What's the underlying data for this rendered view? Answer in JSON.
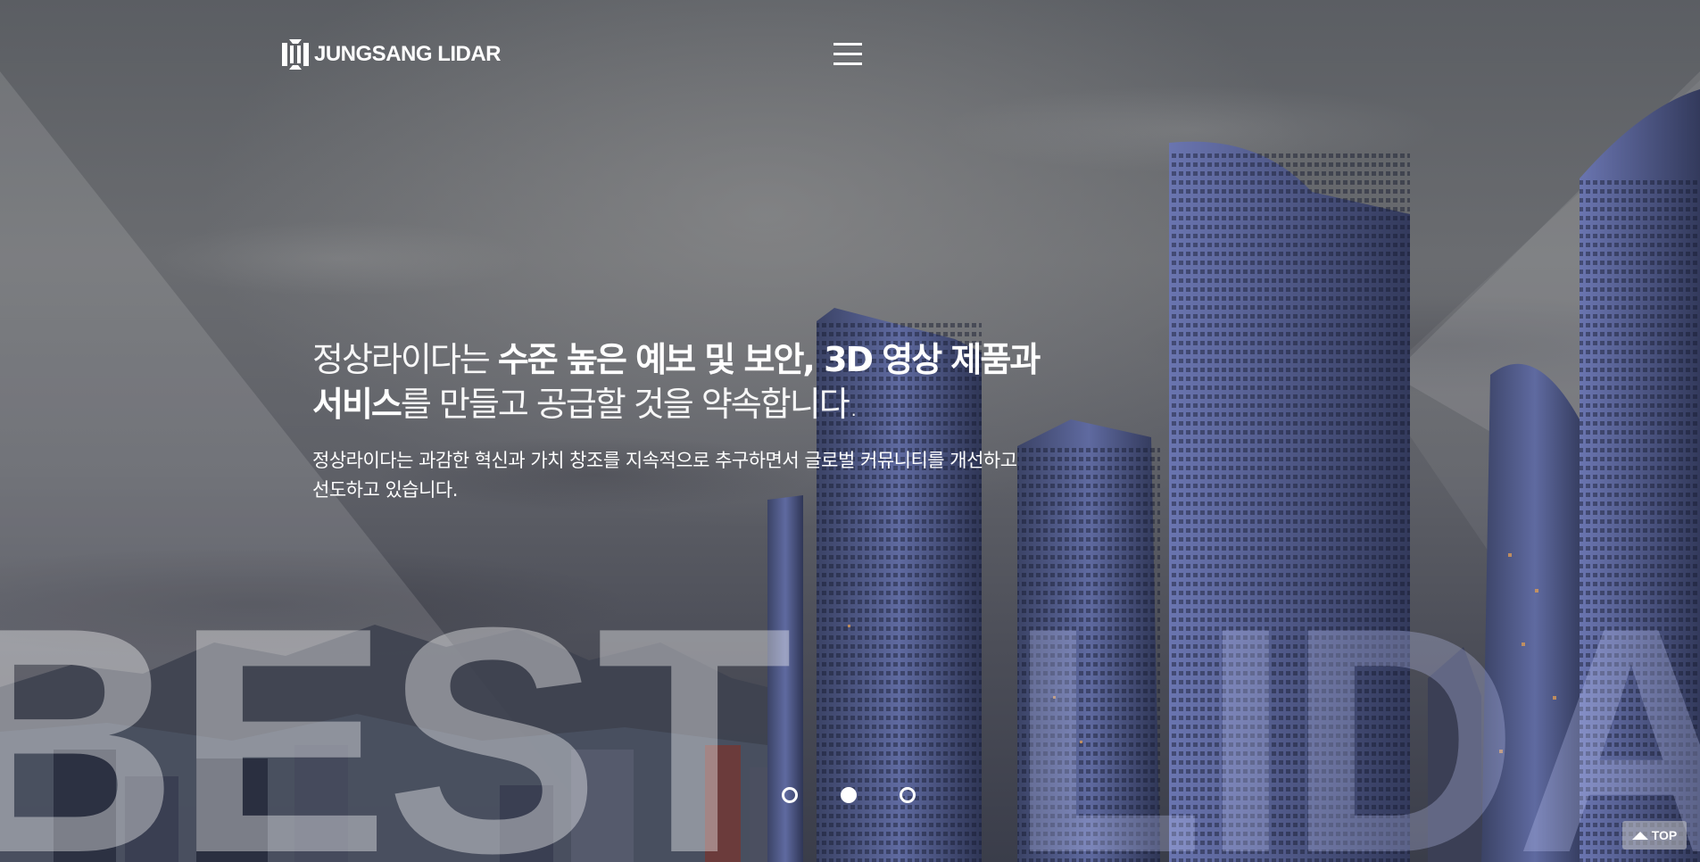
{
  "header": {
    "logo_text": "JUNGSANG LIDAR",
    "menu_icon": "hamburger-menu-icon"
  },
  "hero": {
    "headline": {
      "line1_light": "정상라이다는 ",
      "line1_bold": "수준 높은 예보 및 보안, 3D 영상 제품과",
      "line2_bold": "서비스",
      "line2_light": "를 만들고 공급할 것을 약속합니다."
    },
    "subline": {
      "line1": "정상라이다는 과감한 혁신과 가치 창조를 지속적으로 추구하면서 글로벌 커뮤니티를 개선하고",
      "line2": "선도하고 있습니다."
    },
    "background_words": {
      "left": "BEST",
      "right": "LIDAR"
    }
  },
  "slider": {
    "dots": [
      {
        "state": "inactive"
      },
      {
        "state": "active"
      },
      {
        "state": "inactive"
      }
    ]
  },
  "top_button": {
    "label": "TOP",
    "icon": "arrow-up-triangle-icon"
  },
  "colors": {
    "text": "#ffffff",
    "building_blue": "#5a6aa8",
    "sky": "#6a6c70"
  }
}
